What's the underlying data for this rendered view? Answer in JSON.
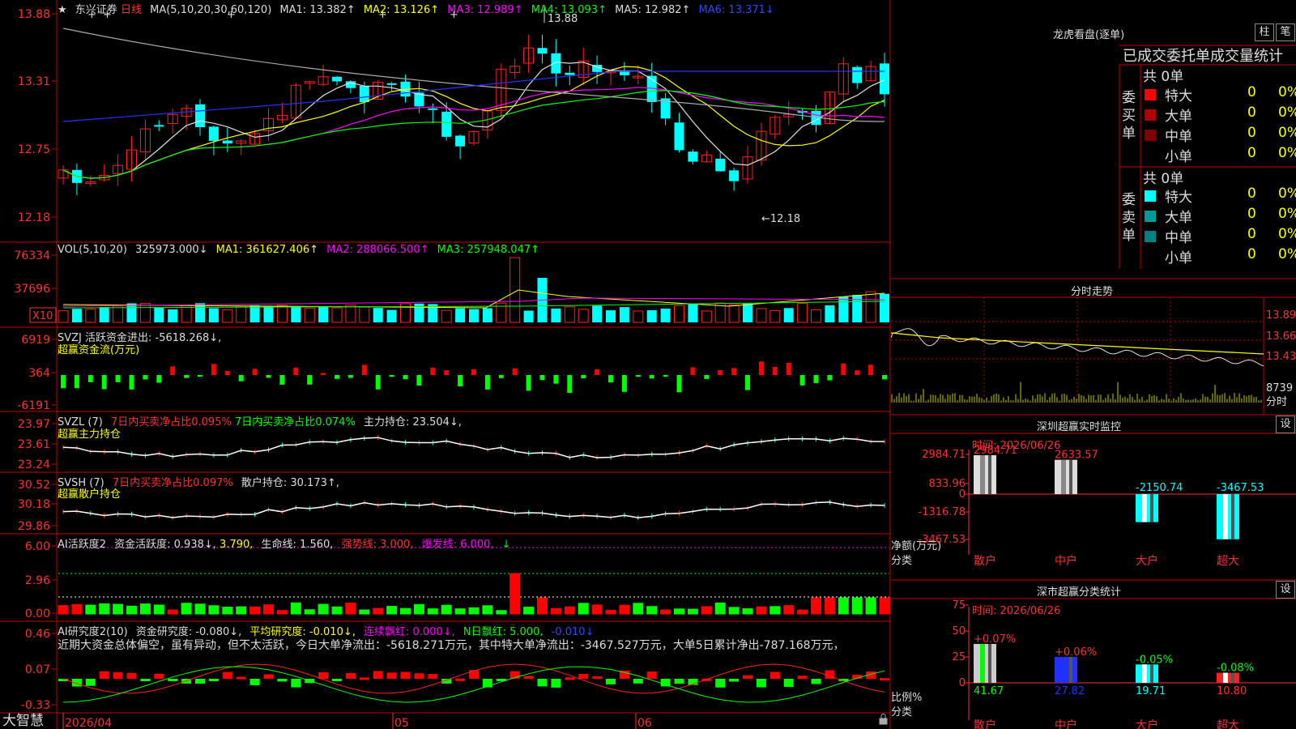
{
  "app": {
    "brand": "大智慧",
    "lock_icon": "lock-icon"
  },
  "kline": {
    "stock_name": "东兴证券",
    "period": "日线",
    "ma_header": "MA(5,10,20,30,60,120)",
    "ma1": "MA1: 13.382↑",
    "ma2": "MA2: 13.126↑",
    "ma3": "MA3: 12.989↑",
    "ma4": "MA4: 13.093↑",
    "ma5": "MA5: 12.982↑",
    "ma6": "MA6: 13.371↓",
    "axis": [
      "13.88",
      "13.31",
      "12.75",
      "12.18"
    ],
    "high_label": "13.88",
    "low_label": "←12.18"
  },
  "vol": {
    "header": "VOL(5,10,20)",
    "value": "325973.000↓",
    "ma1": "MA1: 361627.406↑",
    "ma2": "MA2: 288066.500↑",
    "ma3": "MA3: 257948.047↑",
    "axis": [
      "76334",
      "37696"
    ],
    "unit": "X10"
  },
  "svzj": {
    "header": "SVZJ  活跃资金进出: -5618.268↓,",
    "sub": "超赢资金流(万元)",
    "axis": [
      "6919",
      "364",
      "-6191"
    ]
  },
  "svzl": {
    "name": "SVZL (7)",
    "red": "7日内买卖净占比0.095%",
    "green": "7日内买卖净占比0.074%",
    "white": "主力持仓: 23.504↓,",
    "sub": "超赢主力持仓",
    "axis": [
      "23.97",
      "23.61",
      "23.24"
    ]
  },
  "svsh": {
    "name": "SVSH (7)",
    "red": "7日内买卖净占比0.097%",
    "white": "散户持仓: 30.173↑,",
    "sub": "超赢散户持仓",
    "axis": [
      "30.52",
      "30.18",
      "29.86"
    ]
  },
  "ai1": {
    "name": "AI活跃度2",
    "v1": "资金活跃度: 0.938↓,",
    "v2": "3.790,",
    "v3": "生命线: 1.560,",
    "v4": "强势线: 3.000,",
    "v5": "爆发线: 6.000,",
    "axis": [
      "6.00",
      "2.96",
      "0.00"
    ]
  },
  "ai2": {
    "name": "AI研究度2(10)",
    "v1": "资金研究度: -0.080↓,",
    "v2": "平均研究度: -0.010↓,",
    "v3": "连续飘红: 0.000↓,",
    "v4": "N日飘红: 5.000,",
    "v5": "-0.010↓",
    "comment": "近期大资金总体偏空，虽有异动，但不太活跃，今日大单净流出：-5618.271万元，其中特大单净流出：-3467.527万元，大单5日累计净出-787.168万元，",
    "axis": [
      "0.46",
      "0.07",
      "-0.33"
    ]
  },
  "dates": [
    "2026/04",
    "05",
    "06"
  ],
  "longhu": {
    "title": "龙虎看盘(逐单)",
    "btn1": "柱",
    "btn2": "笔",
    "tabs": "已成交委托单成交量统计",
    "buy_label": "委买单",
    "sell_label": "委卖单",
    "buy_total": "共 0单",
    "sell_total": "共 0单",
    "buy_rows": [
      {
        "name": "特大",
        "count": "0",
        "pct": "0%"
      },
      {
        "name": "大单",
        "count": "0",
        "pct": "0%"
      },
      {
        "name": "中单",
        "count": "0",
        "pct": "0%"
      },
      {
        "name": "小单",
        "count": "0",
        "pct": "0%"
      }
    ],
    "sell_rows": [
      {
        "name": "特大",
        "count": "0",
        "pct": "0%"
      },
      {
        "name": "大单",
        "count": "0",
        "pct": "0%"
      },
      {
        "name": "中单",
        "count": "0",
        "pct": "0%"
      },
      {
        "name": "小单",
        "count": "0",
        "pct": "0%"
      }
    ],
    "buy_colors": [
      "#ff0000",
      "#b00000",
      "#800000",
      "#000000"
    ],
    "sell_colors": [
      "#00ffff",
      "#009a9a",
      "#008080",
      "#000000"
    ]
  },
  "intraday": {
    "title": "分时走势",
    "axis": [
      "13.89",
      "13.66",
      "13.43"
    ],
    "vol_value": "8739",
    "vol_unit": "分时"
  },
  "monitor": {
    "title": "深圳超赢实时监控",
    "setting_btn": "设",
    "time": "时间: 2026/06/26",
    "axis": [
      "2984.71",
      "833.96",
      "0",
      "-1316.78",
      "-3467.53"
    ],
    "ylabel1": "净额(万元)",
    "ylabel2": "分类",
    "categories": [
      "散户",
      "中户",
      "大户",
      "超大"
    ],
    "values": [
      2984.71,
      2633.57,
      -2150.74,
      -3467.53
    ],
    "value_labels": [
      "2984.71",
      "2633.57",
      "-2150.74",
      "-3467.53"
    ]
  },
  "classify": {
    "title": "深市超赢分类统计",
    "setting_btn": "设",
    "time": "时间: 2026/06/26",
    "axis": [
      "75",
      "50",
      "25",
      "0"
    ],
    "ylabel1": "比例%",
    "ylabel2": "分类",
    "categories": [
      "散户",
      "中户",
      "大户",
      "超大"
    ],
    "values": [
      41.67,
      27.82,
      19.71,
      10.8
    ],
    "value_labels": [
      "41.67",
      "27.82",
      "19.71",
      "10.80"
    ],
    "changes": [
      "+0.07%",
      "+0.06%",
      "-0.05%",
      "-0.08%"
    ]
  }
}
